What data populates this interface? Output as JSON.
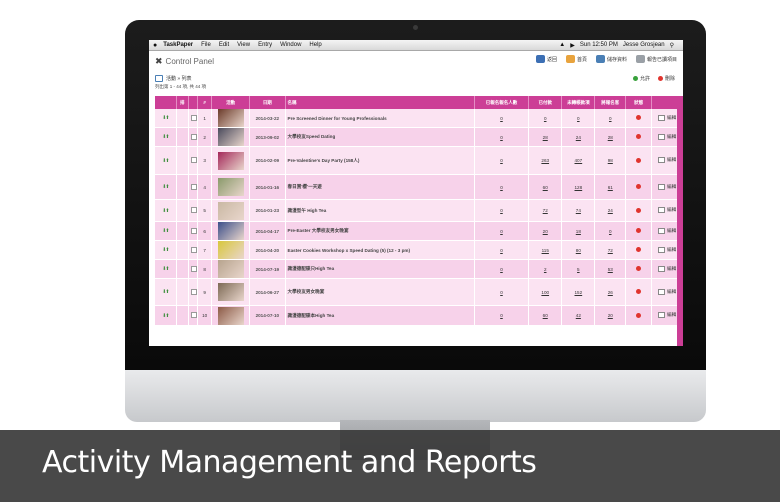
{
  "menubar": {
    "app": "TaskPaper",
    "items": [
      "File",
      "Edit",
      "View",
      "Entry",
      "Window",
      "Help"
    ],
    "clock": "Sun 12:50 PM",
    "user": "Jesse Grosjean"
  },
  "header": {
    "logo_text": "Control Panel",
    "actions": [
      {
        "label": "返回",
        "color": "#3c6fb4"
      },
      {
        "label": "首頁",
        "color": "#e8a33d"
      },
      {
        "label": "儲存資料",
        "color": "#4a7fb5"
      },
      {
        "label": "報告已讀項目",
        "color": "#9aa0a6"
      }
    ]
  },
  "breadcrumb": "活動 » 列表",
  "sub_actions": [
    {
      "label": "允許",
      "color": "#38a13b"
    },
    {
      "label": "刪除",
      "color": "#e0342e"
    }
  ],
  "record_count": "列出第 1 - 44 項, 共 44 項",
  "table": {
    "headers": [
      "排",
      "#",
      "活動",
      "日期",
      "名稱",
      "已報名報名人數",
      "已付款",
      "未轉帳款項",
      "將報名客",
      "狀態",
      ""
    ],
    "edit_label": "編輯",
    "rows": [
      {
        "no": "1",
        "date": "2014-03-22",
        "name": "Pre Screened Dinner for Young Professionals",
        "c1": "0",
        "c2": "0",
        "c3": "0",
        "c4": "0",
        "thumb": "#6b3b2a"
      },
      {
        "no": "2",
        "date": "2013-09-02",
        "name": "大學校友Speed Dating",
        "c1": "0",
        "c2": "28",
        "c3": "24",
        "c4": "28",
        "thumb": "#4a4a5c"
      },
      {
        "no": "3",
        "date": "2014-02-09",
        "name": "Pre-Valentine's Day Party (158人)",
        "c1": "0",
        "c2": "263",
        "c3": "407",
        "c4": "98",
        "thumb": "#a4285a"
      },
      {
        "no": "4",
        "date": "2014-01-16",
        "name": "春日賞'櫻'一天遊",
        "c1": "0",
        "c2": "60",
        "c3": "128",
        "c4": "61",
        "thumb": "#8a9a6b"
      },
      {
        "no": "5",
        "date": "2014-01-23",
        "name": "識漫型午 High Tea",
        "c1": "0",
        "c2": "72",
        "c3": "74",
        "c4": "24",
        "thumb": "#c9b8a3"
      },
      {
        "no": "6",
        "date": "2014-04-17",
        "name": "Pre-Easter 大學校友男女晚宴",
        "c1": "0",
        "c2": "20",
        "c3": "18",
        "c4": "0",
        "thumb": "#3c4f8a"
      },
      {
        "no": "7",
        "date": "2014-04-20",
        "name": "Easter Cookies Workshop x Speed Dating (5) (12 - 3 pm)",
        "c1": "0",
        "c2": "115",
        "c3": "80",
        "c4": "72",
        "thumb": "#d8c73c"
      },
      {
        "no": "8",
        "date": "2014-07-19",
        "name": "識漫德配碟只High Tea",
        "c1": "0",
        "c2": "2",
        "c3": "5",
        "c4": "53",
        "thumb": "#b7a48e"
      },
      {
        "no": "9",
        "date": "2014-06-27",
        "name": "大學校友男女晚宴",
        "c1": "0",
        "c2": "100",
        "c3": "152",
        "c4": "26",
        "thumb": "#7d6a55"
      },
      {
        "no": "10",
        "date": "2014-07-10",
        "name": "識漫德配碟本High Tea",
        "c1": "0",
        "c2": "60",
        "c3": "42",
        "c4": "20",
        "thumb": "#8c5a46"
      }
    ]
  },
  "caption": "Activity Management and Reports",
  "colors": {
    "accent": "#cc3e96",
    "row_a": "#fbe3f2",
    "row_b": "#f7d2ea",
    "caption_bg": "#3a3a3a"
  }
}
